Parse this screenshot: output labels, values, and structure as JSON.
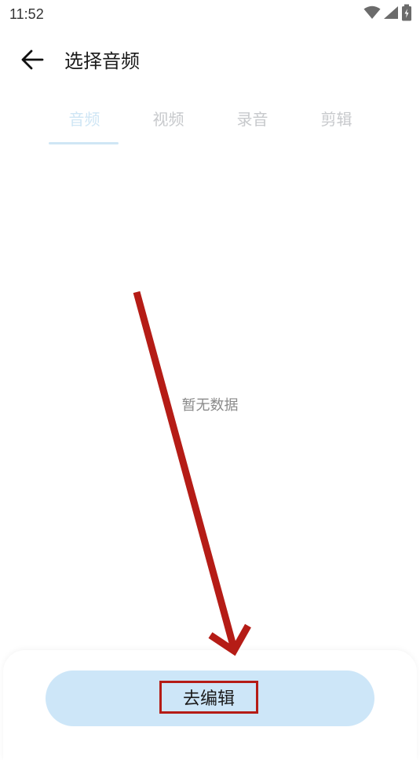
{
  "status_bar": {
    "time": "11:52",
    "icons": [
      "wifi-icon",
      "signal-icon",
      "battery-charging-icon"
    ]
  },
  "header": {
    "back_icon": "arrow-left-icon",
    "title": "选择音频"
  },
  "tabs": [
    {
      "label": "音频",
      "active": true
    },
    {
      "label": "视频",
      "active": false
    },
    {
      "label": "录音",
      "active": false
    },
    {
      "label": "剪辑",
      "active": false
    }
  ],
  "empty_state": {
    "text": "暂无数据"
  },
  "bottom": {
    "edit_label": "去编辑"
  },
  "colors": {
    "accent_light": "#cde6f8",
    "tab_active": "#cfe6f5",
    "tab_inactive": "#c7c9cc",
    "annotation_red": "#b51c16"
  }
}
